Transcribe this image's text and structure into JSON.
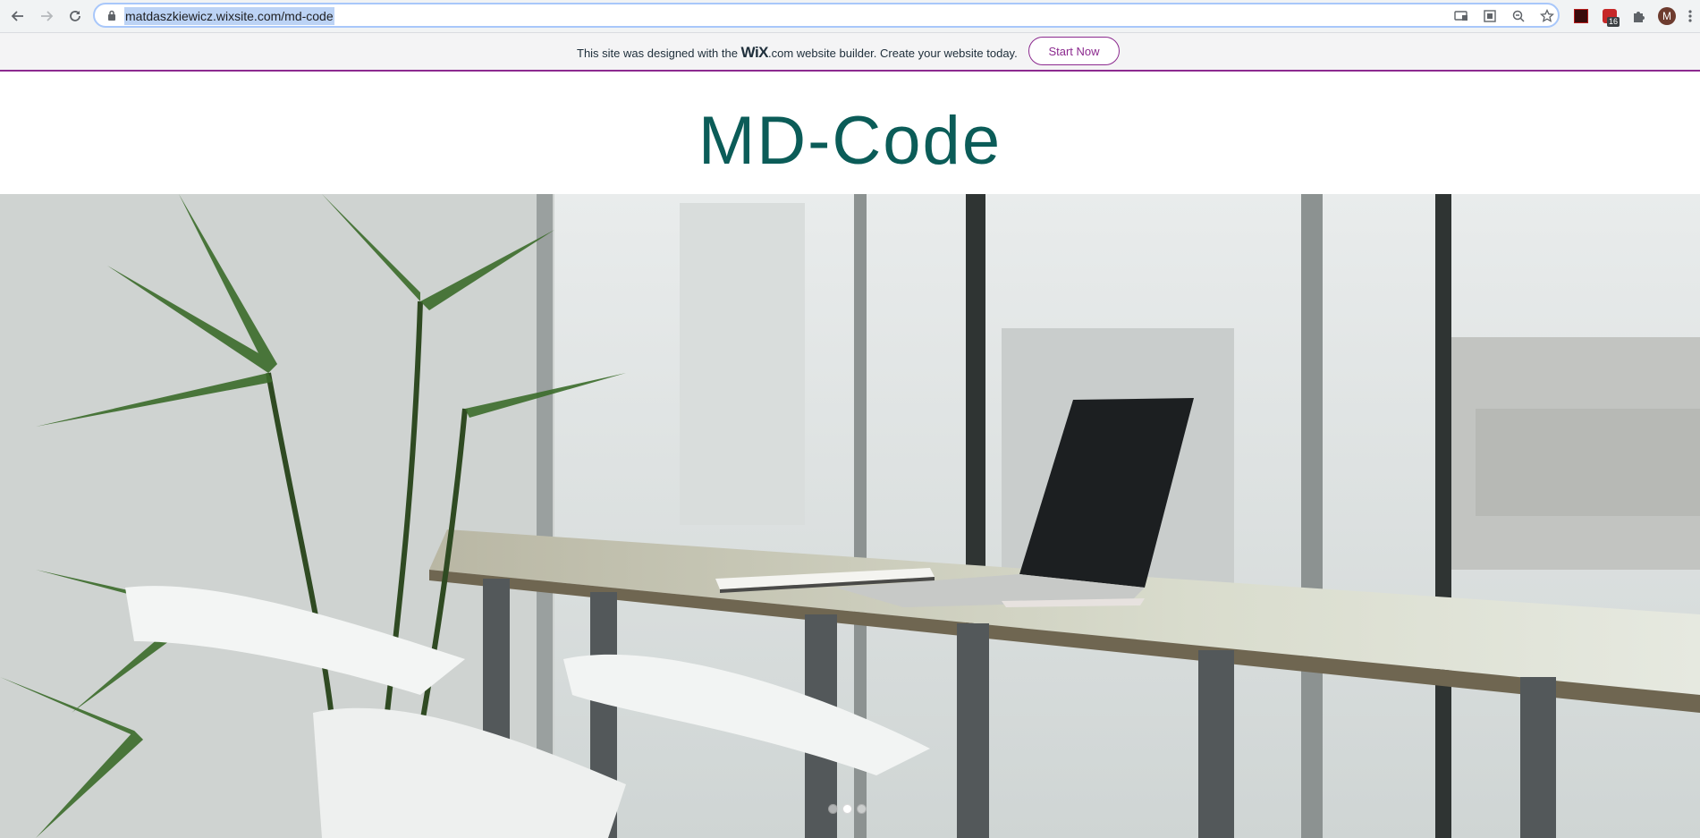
{
  "browser": {
    "url": "matdaszkiewicz.wixsite.com/md-code",
    "profile_initial": "M",
    "extension_badge": "16"
  },
  "wix_banner": {
    "text_before": "This site was designed with the ",
    "logo_text": "WiX",
    "text_after": ".com website builder. Create your website today.",
    "cta_label": "Start Now"
  },
  "site": {
    "title": "MD-Code"
  },
  "slideshow": {
    "slide_count": 3,
    "active_index": 1
  },
  "colors": {
    "wix_accent": "#8c2a8f",
    "title_color": "#0b5c58"
  }
}
